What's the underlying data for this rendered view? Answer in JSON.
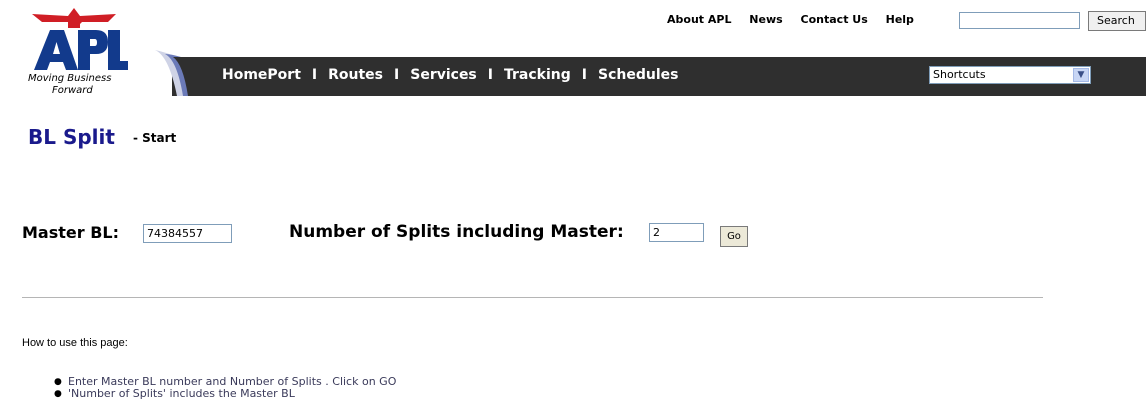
{
  "brand": {
    "logo_text": "APL",
    "tagline_line1": "Moving Business",
    "tagline_line2": "Forward"
  },
  "top_links": [
    "About APL",
    "News",
    "Contact Us",
    "Help"
  ],
  "search": {
    "value": "",
    "button_label": "Search"
  },
  "nav": {
    "items": [
      "HomePort",
      "Routes",
      "Services",
      "Tracking",
      "Schedules"
    ],
    "separator": "I",
    "shortcuts_value": "Shortcuts"
  },
  "page": {
    "title": "BL Split",
    "subtitle": "- Start"
  },
  "form": {
    "master_label": "Master BL:",
    "master_value": "74384557",
    "splits_label": "Number of Splits including Master:",
    "splits_value": "2",
    "go_label": "Go"
  },
  "help": {
    "heading": "How to use this page:",
    "bullets": [
      "Enter Master BL number and Number of Splits . Click on GO",
      "'Number of Splits' includes the Master BL"
    ]
  },
  "colors": {
    "title": "#1a1a8c",
    "logo_red": "#d01e25",
    "logo_blue": "#123a8c",
    "navbar": "#2f2f2f"
  }
}
